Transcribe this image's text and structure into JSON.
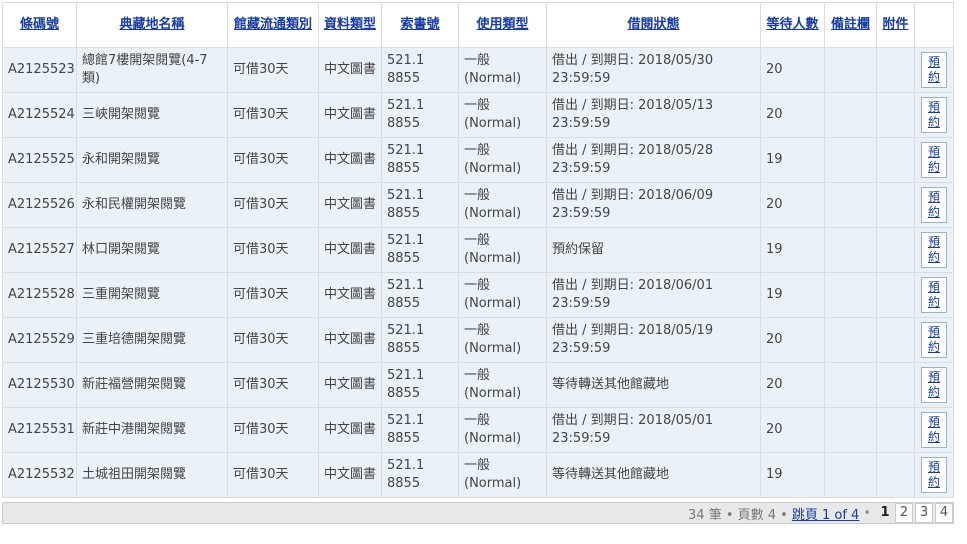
{
  "columns": [
    "條碼號",
    "典藏地名稱",
    "館藏流通類別",
    "資料類型",
    "索書號",
    "使用類型",
    "借閱狀態",
    "等待人數",
    "備註欄",
    "附件",
    ""
  ],
  "rows": [
    {
      "barcode": "A2125523",
      "location": "總館7樓開架閱覽(4-7類)",
      "circ": "可借30天",
      "type": "中文圖書",
      "callno": "521.1 8855",
      "usage": "一般 (Normal)",
      "status": "借出 / 到期日: 2018/05/30 23:59:59",
      "waiting": "20",
      "action": "預約"
    },
    {
      "barcode": "A2125524",
      "location": "三峽開架閱覽",
      "circ": "可借30天",
      "type": "中文圖書",
      "callno": "521.1 8855",
      "usage": "一般 (Normal)",
      "status": "借出 / 到期日: 2018/05/13 23:59:59",
      "waiting": "20",
      "action": "預約"
    },
    {
      "barcode": "A2125525",
      "location": "永和開架閱覽",
      "circ": "可借30天",
      "type": "中文圖書",
      "callno": "521.1 8855",
      "usage": "一般 (Normal)",
      "status": "借出 / 到期日: 2018/05/28 23:59:59",
      "waiting": "19",
      "action": "預約"
    },
    {
      "barcode": "A2125526",
      "location": "永和民權開架閱覽",
      "circ": "可借30天",
      "type": "中文圖書",
      "callno": "521.1 8855",
      "usage": "一般 (Normal)",
      "status": "借出 / 到期日: 2018/06/09 23:59:59",
      "waiting": "20",
      "action": "預約"
    },
    {
      "barcode": "A2125527",
      "location": "林口開架閱覽",
      "circ": "可借30天",
      "type": "中文圖書",
      "callno": "521.1 8855",
      "usage": "一般 (Normal)",
      "status": "預約保留",
      "waiting": "19",
      "action": "預約"
    },
    {
      "barcode": "A2125528",
      "location": "三重開架閱覽",
      "circ": "可借30天",
      "type": "中文圖書",
      "callno": "521.1 8855",
      "usage": "一般 (Normal)",
      "status": "借出 / 到期日: 2018/06/01 23:59:59",
      "waiting": "19",
      "action": "預約"
    },
    {
      "barcode": "A2125529",
      "location": "三重培德開架閱覽",
      "circ": "可借30天",
      "type": "中文圖書",
      "callno": "521.1 8855",
      "usage": "一般 (Normal)",
      "status": "借出 / 到期日: 2018/05/19 23:59:59",
      "waiting": "20",
      "action": "預約"
    },
    {
      "barcode": "A2125530",
      "location": "新莊福營開架閱覽",
      "circ": "可借30天",
      "type": "中文圖書",
      "callno": "521.1 8855",
      "usage": "一般 (Normal)",
      "status": "等待轉送其他館藏地",
      "waiting": "20",
      "action": "預約"
    },
    {
      "barcode": "A2125531",
      "location": "新莊中港開架閱覽",
      "circ": "可借30天",
      "type": "中文圖書",
      "callno": "521.1 8855",
      "usage": "一般 (Normal)",
      "status": "借出 / 到期日: 2018/05/01 23:59:59",
      "waiting": "20",
      "action": "預約"
    },
    {
      "barcode": "A2125532",
      "location": "土城祖田開架閱覽",
      "circ": "可借30天",
      "type": "中文圖書",
      "callno": "521.1 8855",
      "usage": "一般 (Normal)",
      "status": "等待轉送其他館藏地",
      "waiting": "19",
      "action": "預約"
    }
  ],
  "pager": {
    "summary": "34 筆 • 頁數 4 •",
    "jump_label": "跳頁 1 of 4",
    "separator": "•",
    "pages": [
      "1",
      "2",
      "3",
      "4"
    ],
    "current": "1"
  },
  "colors": {
    "row_bg": "#eaf2f8",
    "link": "#1a3c9e",
    "border": "#d9dde0",
    "pager_bg": "#e6e8ea"
  }
}
